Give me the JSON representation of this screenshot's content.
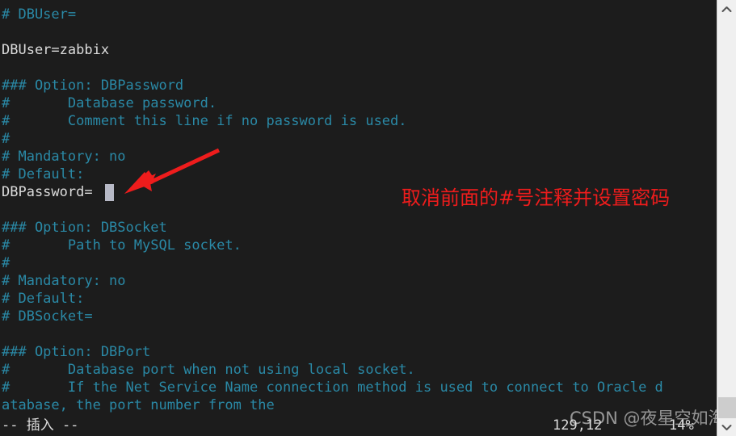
{
  "app": {
    "kind": "terminal-text-editor",
    "editor": "vi",
    "background_color": "#1c1c1c",
    "comment_color": "#2a89a6",
    "text_color": "#dcdcdc",
    "annotation_color": "#ee1c1c",
    "cursor_color": "#b7b9c6"
  },
  "terminal": {
    "lines": [
      {
        "text": "# DBUser=",
        "style": "comment"
      },
      {
        "text": "",
        "style": "comment"
      },
      {
        "text": "DBUser=zabbix",
        "style": "plain"
      },
      {
        "text": "",
        "style": "comment"
      },
      {
        "text": "### Option: DBPassword",
        "style": "comment"
      },
      {
        "text": "#       Database password.",
        "style": "comment"
      },
      {
        "text": "#       Comment this line if no password is used.",
        "style": "comment"
      },
      {
        "text": "#",
        "style": "comment"
      },
      {
        "text": "# Mandatory: no",
        "style": "comment"
      },
      {
        "text": "# Default:",
        "style": "comment"
      },
      {
        "text": "DBPassword=",
        "style": "plain"
      },
      {
        "text": "",
        "style": "comment"
      },
      {
        "text": "### Option: DBSocket",
        "style": "comment"
      },
      {
        "text": "#       Path to MySQL socket.",
        "style": "comment"
      },
      {
        "text": "#",
        "style": "comment"
      },
      {
        "text": "# Mandatory: no",
        "style": "comment"
      },
      {
        "text": "# Default:",
        "style": "comment"
      },
      {
        "text": "# DBSocket=",
        "style": "comment"
      },
      {
        "text": "",
        "style": "comment"
      },
      {
        "text": "### Option: DBPort",
        "style": "comment"
      },
      {
        "text": "#       Database port when not using local socket.",
        "style": "comment"
      },
      {
        "text": "#       If the Net Service Name connection method is used to connect to Oracle d",
        "style": "comment"
      },
      {
        "text": "atabase, the port number from the",
        "style": "comment"
      }
    ]
  },
  "statusbar": {
    "mode": "-- 插入 --",
    "cursor_position": "129,12",
    "scroll_percent": "14%"
  },
  "annotation": {
    "text": "取消前面的#号注释并设置密码",
    "arrow_color": "#ee1c1c"
  },
  "watermark": {
    "text": "CSDN @夜星空如海"
  },
  "scrollbar": {
    "up_icon": "chevron-up-icon",
    "down_icon": "chevron-down-icon"
  }
}
